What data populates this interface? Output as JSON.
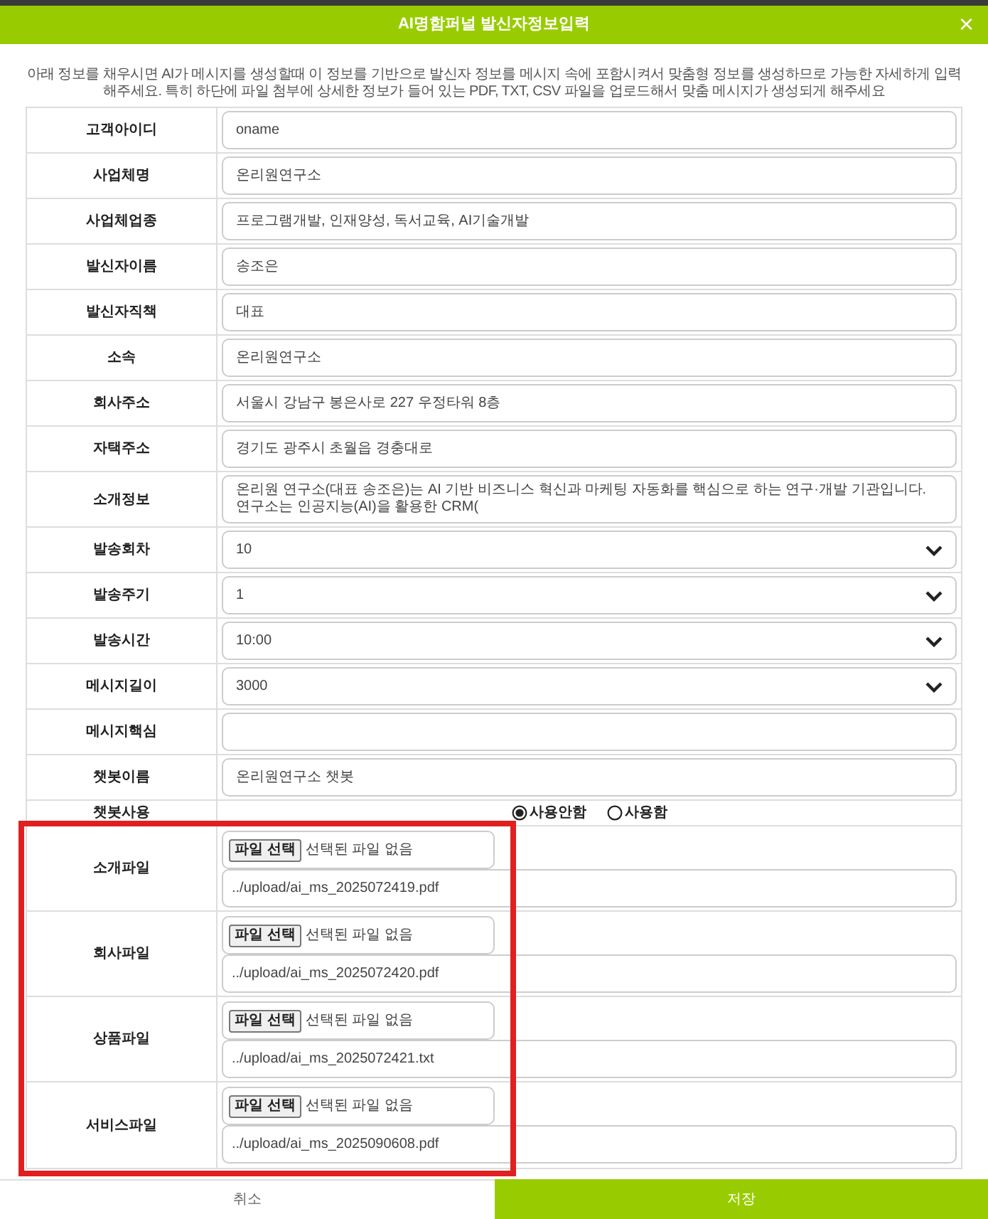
{
  "dialog": {
    "title": "AI명함퍼널 발신자정보입력",
    "close": "×"
  },
  "intro": "아래 정보를 채우시면 AI가 메시지를 생성할때 이 정보를 기반으로 발신자 정보를 메시지 속에 포함시켜서 맞춤형 정보를 생성하므로 가능한 자세하게 입력해주세요. 특히 하단에 파일 첨부에 상세한 정보가 들어 있는 PDF, TXT, CSV 파일을 업로드해서 맞춤 메시지가 생성되게 해주세요",
  "fields": [
    {
      "label": "고객아이디",
      "kind": "text",
      "value": "oname"
    },
    {
      "label": "사업체명",
      "kind": "text",
      "value": "온리원연구소"
    },
    {
      "label": "사업체업종",
      "kind": "text",
      "value": "프로그램개발, 인재양성, 독서교육, AI기술개발"
    },
    {
      "label": "발신자이름",
      "kind": "text",
      "value": "송조은"
    },
    {
      "label": "발신자직책",
      "kind": "text",
      "value": "대표"
    },
    {
      "label": "소속",
      "kind": "text",
      "value": "온리원연구소"
    },
    {
      "label": "회사주소",
      "kind": "text",
      "value": "서울시 강남구 봉은사로 227 우정타워 8층"
    },
    {
      "label": "자택주소",
      "kind": "text",
      "value": "경기도 광주시 초월읍 경충대로"
    },
    {
      "label": "소개정보",
      "kind": "text",
      "value": "온리원 연구소(대표 송조은)는 AI 기반 비즈니스 혁신과 마케팅 자동화를 핵심으로 하는 연구·개발 기관입니다. 연구소는 인공지능(AI)을 활용한 CRM("
    },
    {
      "label": "발송회차",
      "kind": "select",
      "value": "10"
    },
    {
      "label": "발송주기",
      "kind": "select",
      "value": "1"
    },
    {
      "label": "발송시간",
      "kind": "select",
      "value": "10:00"
    },
    {
      "label": "메시지길이",
      "kind": "select",
      "value": "3000"
    },
    {
      "label": "메시지핵심",
      "kind": "text"
    },
    {
      "label": "챗봇이름",
      "kind": "text",
      "value": "온리원연구소 챗봇"
    }
  ],
  "chatbot_use": {
    "label": "챗봇사용",
    "options": [
      {
        "label": "사용안함",
        "selected": true
      },
      {
        "label": "사용함",
        "selected": false
      }
    ]
  },
  "files": [
    {
      "label": "소개파일",
      "button": "파일 선택",
      "status": "선택된 파일 없음",
      "path": "../upload/ai_ms_2025072419.pdf"
    },
    {
      "label": "회사파일",
      "button": "파일 선택",
      "status": "선택된 파일 없음",
      "path": "../upload/ai_ms_2025072420.pdf"
    },
    {
      "label": "상품파일",
      "button": "파일 선택",
      "status": "선택된 파일 없음",
      "path": "../upload/ai_ms_2025072421.txt"
    },
    {
      "label": "서비스파일",
      "button": "파일 선택",
      "status": "선택된 파일 없음",
      "path": "../upload/ai_ms_2025090608.pdf"
    }
  ],
  "buttons": [
    {
      "label": "취소",
      "kind": "cancel"
    },
    {
      "label": "저장",
      "kind": "save"
    }
  ]
}
